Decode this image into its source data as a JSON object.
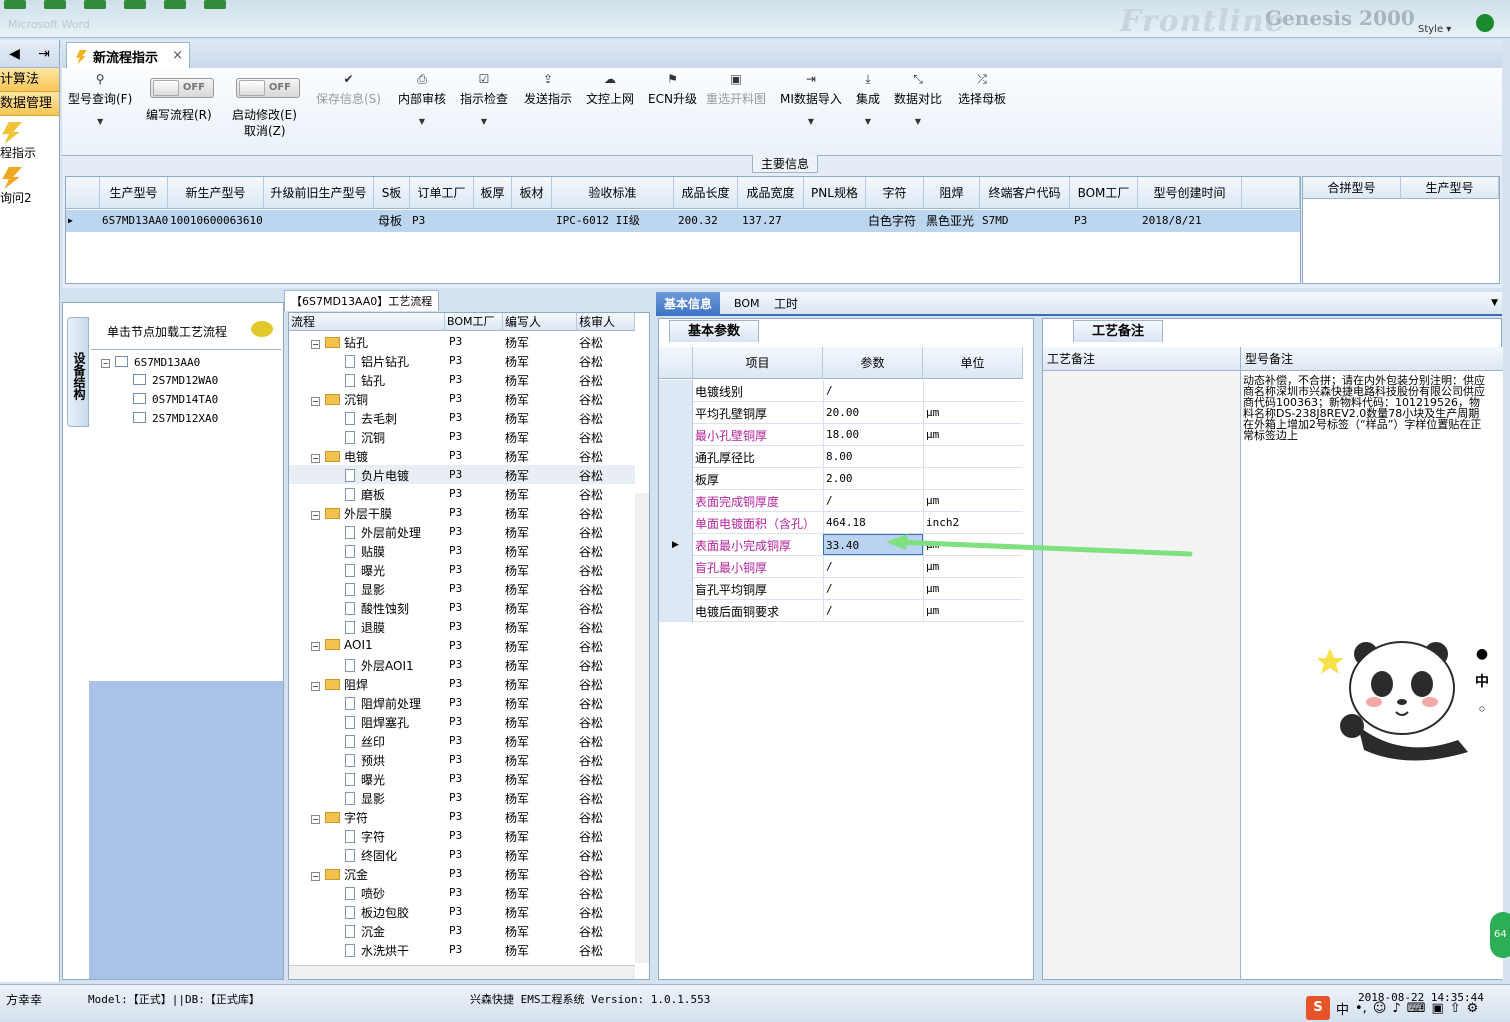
{
  "window": {
    "brand": "Frontline",
    "brand2": "Genesis 2000",
    "style_label": "Style ▾",
    "ghost_title": "Microsoft Word"
  },
  "leftnav": {
    "items": [
      "计算法",
      "数据管理"
    ],
    "actions": [
      "程指示",
      "询问2"
    ]
  },
  "tabs": {
    "main": "新流程指示",
    "close": "×"
  },
  "toolbar": {
    "items": [
      {
        "label": "型号查询(F)",
        "icon": "search-icon",
        "disabled": false,
        "dropdown": true
      },
      {
        "label": "保存信息(S)",
        "icon": "check-icon",
        "disabled": true,
        "dropdown": false
      },
      {
        "label": "内部审核",
        "icon": "printer-icon",
        "disabled": false,
        "dropdown": true
      },
      {
        "label": "指示检查",
        "icon": "checklist-icon",
        "disabled": false,
        "dropdown": true
      },
      {
        "label": "发送指示",
        "icon": "upload-icon",
        "disabled": false,
        "dropdown": false
      },
      {
        "label": "文控上网",
        "icon": "cloud-upload-icon",
        "disabled": false,
        "dropdown": false
      },
      {
        "label": "ECN升级",
        "icon": "ecn-icon",
        "disabled": false,
        "dropdown": false
      },
      {
        "label": "重选开料图",
        "icon": "image-icon",
        "disabled": true,
        "dropdown": false
      },
      {
        "label": "MI数据导入",
        "icon": "import-icon",
        "disabled": false,
        "dropdown": true
      },
      {
        "label": "集成",
        "icon": "download-icon",
        "disabled": false,
        "dropdown": true
      },
      {
        "label": "数据对比",
        "icon": "compare-icon",
        "disabled": false,
        "dropdown": true
      },
      {
        "label": "选择母板",
        "icon": "shuffle-icon",
        "disabled": false,
        "dropdown": false
      }
    ],
    "toggle1": {
      "state": "OFF",
      "label": "编写流程(R)"
    },
    "toggle2": {
      "state": "OFF",
      "label": "启动修改(E)",
      "label2": "取消(Z)"
    }
  },
  "main_info": {
    "title": "主要信息",
    "headers": [
      "生产型号",
      "新生产型号",
      "升级前旧生产型号",
      "S板",
      "订单工厂",
      "板厚",
      "板材",
      "验收标准",
      "成品长度",
      "成品宽度",
      "PNL规格",
      "字符",
      "阻焊",
      "终端客户代码",
      "BOM工厂",
      "型号创建时间"
    ],
    "row": [
      "6S7MD13AA0",
      "10010600063610",
      "",
      "母板",
      "P3",
      "",
      "",
      "IPC-6012 II级",
      "200.32",
      "137.27",
      "",
      "白色字符",
      "黑色亚光",
      "S7MD",
      "P3",
      "2018/8/21"
    ],
    "side_headers": [
      "合拼型号",
      "生产型号"
    ]
  },
  "device_panel": {
    "vtab": "设备结构",
    "header": "单击节点加载工艺流程",
    "tree": [
      "6S7MD13AA0",
      "2S7MD12WA0",
      "0S7MD14TA0",
      "2S7MD12XA0"
    ]
  },
  "process": {
    "tab": "【6S7MD13AA0】工艺流程",
    "headers": [
      "流程",
      "BOM工厂",
      "编写人",
      "核审人"
    ],
    "rows": [
      {
        "name": "钻孔",
        "folder": true,
        "factory": "P3",
        "writer": "杨军",
        "reviewer": "谷松"
      },
      {
        "name": "铝片钻孔",
        "folder": false,
        "factory": "P3",
        "writer": "杨军",
        "reviewer": "谷松"
      },
      {
        "name": "钻孔",
        "folder": false,
        "factory": "P3",
        "writer": "杨军",
        "reviewer": "谷松"
      },
      {
        "name": "沉铜",
        "folder": true,
        "factory": "P3",
        "writer": "杨军",
        "reviewer": "谷松"
      },
      {
        "name": "去毛刺",
        "folder": false,
        "factory": "P3",
        "writer": "杨军",
        "reviewer": "谷松"
      },
      {
        "name": "沉铜",
        "folder": false,
        "factory": "P3",
        "writer": "杨军",
        "reviewer": "谷松"
      },
      {
        "name": "电镀",
        "folder": true,
        "factory": "P3",
        "writer": "杨军",
        "reviewer": "谷松"
      },
      {
        "name": "负片电镀",
        "folder": false,
        "factory": "P3",
        "writer": "杨军",
        "reviewer": "谷松",
        "selected": true
      },
      {
        "name": "磨板",
        "folder": false,
        "factory": "P3",
        "writer": "杨军",
        "reviewer": "谷松"
      },
      {
        "name": "外层干膜",
        "folder": true,
        "factory": "P3",
        "writer": "杨军",
        "reviewer": "谷松"
      },
      {
        "name": "外层前处理",
        "folder": false,
        "factory": "P3",
        "writer": "杨军",
        "reviewer": "谷松"
      },
      {
        "name": "贴膜",
        "folder": false,
        "factory": "P3",
        "writer": "杨军",
        "reviewer": "谷松"
      },
      {
        "name": "曝光",
        "folder": false,
        "factory": "P3",
        "writer": "杨军",
        "reviewer": "谷松"
      },
      {
        "name": "显影",
        "folder": false,
        "factory": "P3",
        "writer": "杨军",
        "reviewer": "谷松"
      },
      {
        "name": "酸性蚀刻",
        "folder": false,
        "factory": "P3",
        "writer": "杨军",
        "reviewer": "谷松"
      },
      {
        "name": "退膜",
        "folder": false,
        "factory": "P3",
        "writer": "杨军",
        "reviewer": "谷松"
      },
      {
        "name": "AOI1",
        "folder": true,
        "factory": "P3",
        "writer": "杨军",
        "reviewer": "谷松"
      },
      {
        "name": "外层AOI1",
        "folder": false,
        "factory": "P3",
        "writer": "杨军",
        "reviewer": "谷松"
      },
      {
        "name": "阻焊",
        "folder": true,
        "factory": "P3",
        "writer": "杨军",
        "reviewer": "谷松"
      },
      {
        "name": "阻焊前处理",
        "folder": false,
        "factory": "P3",
        "writer": "杨军",
        "reviewer": "谷松"
      },
      {
        "name": "阻焊塞孔",
        "folder": false,
        "factory": "P3",
        "writer": "杨军",
        "reviewer": "谷松"
      },
      {
        "name": "丝印",
        "folder": false,
        "factory": "P3",
        "writer": "杨军",
        "reviewer": "谷松"
      },
      {
        "name": "预烘",
        "folder": false,
        "factory": "P3",
        "writer": "杨军",
        "reviewer": "谷松"
      },
      {
        "name": "曝光",
        "folder": false,
        "factory": "P3",
        "writer": "杨军",
        "reviewer": "谷松"
      },
      {
        "name": "显影",
        "folder": false,
        "factory": "P3",
        "writer": "杨军",
        "reviewer": "谷松"
      },
      {
        "name": "字符",
        "folder": true,
        "factory": "P3",
        "writer": "杨军",
        "reviewer": "谷松"
      },
      {
        "name": "字符",
        "folder": false,
        "factory": "P3",
        "writer": "杨军",
        "reviewer": "谷松"
      },
      {
        "name": "终固化",
        "folder": false,
        "factory": "P3",
        "writer": "杨军",
        "reviewer": "谷松"
      },
      {
        "name": "沉金",
        "folder": true,
        "factory": "P3",
        "writer": "杨军",
        "reviewer": "谷松"
      },
      {
        "name": "喷砂",
        "folder": false,
        "factory": "P3",
        "writer": "杨军",
        "reviewer": "谷松"
      },
      {
        "name": "板边包胶",
        "folder": false,
        "factory": "P3",
        "writer": "杨军",
        "reviewer": "谷松"
      },
      {
        "name": "沉金",
        "folder": false,
        "factory": "P3",
        "writer": "杨军",
        "reviewer": "谷松"
      },
      {
        "name": "水洗烘干",
        "folder": false,
        "factory": "P3",
        "writer": "杨军",
        "reviewer": "谷松"
      }
    ]
  },
  "right_tabs": [
    "基本信息",
    "BOM",
    "工时"
  ],
  "params": {
    "tab": "基本参数",
    "headers": [
      "项目",
      "参数",
      "单位"
    ],
    "rows": [
      {
        "item": "电镀线别",
        "value": "/",
        "unit": "",
        "pink": false
      },
      {
        "item": "平均孔壁铜厚",
        "value": "20.00",
        "unit": "μm",
        "pink": false
      },
      {
        "item": "最小孔壁铜厚",
        "value": "18.00",
        "unit": "μm",
        "pink": true
      },
      {
        "item": "通孔厚径比",
        "value": "8.00",
        "unit": "",
        "pink": false
      },
      {
        "item": "板厚",
        "value": "2.00",
        "unit": "",
        "pink": false
      },
      {
        "item": "表面完成铜厚度",
        "value": "/",
        "unit": "μm",
        "pink": true
      },
      {
        "item": "单面电镀面积（含孔）",
        "value": "464.18",
        "unit": "inch2",
        "pink": true
      },
      {
        "item": "表面最小完成铜厚",
        "value": "33.40",
        "unit": "μm",
        "pink": true,
        "current": true
      },
      {
        "item": "盲孔最小铜厚",
        "value": "/",
        "unit": "μm",
        "pink": true
      },
      {
        "item": "盲孔平均铜厚",
        "value": "/",
        "unit": "μm",
        "pink": false
      },
      {
        "item": "电镀后面铜要求",
        "value": "/",
        "unit": "μm",
        "pink": false
      }
    ]
  },
  "notes": {
    "tab": "工艺备注",
    "left_header": "工艺备注",
    "right_header": "型号备注",
    "text": "动态补偿，不合拼；请在内外包装分别注明：供应商名称深圳市兴森快捷电路科技股份有限公司供应商代码100363；新物料代码：101219526，物料名称DS-238J8REV2.0数量78小块及生产周期在外箱上增加2号标签（“样品”）字样位置贴在正常标签边上"
  },
  "overlay": {
    "side_chars": [
      "●",
      "中",
      "◦"
    ],
    "badge": "64"
  },
  "status": {
    "user": "方幸幸",
    "model": "Model:【正式】||DB:【正式库】",
    "app": "兴森快捷 EMS工程系统 Version: 1.0.1.553",
    "time": "2018-08-22 14:35:44"
  }
}
